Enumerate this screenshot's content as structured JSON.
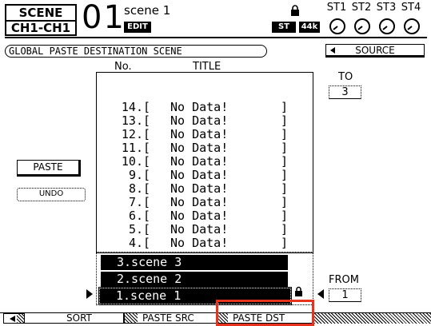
{
  "header": {
    "mode_line1": "SCENE",
    "mode_line2": "CH1-CH1",
    "scene_number": "01",
    "scene_name": "scene 1",
    "edit_badge": "EDIT",
    "st_badge": "ST",
    "sample_rate_badge": "44k",
    "stereo_knobs": [
      {
        "label": "ST1",
        "icon": "knob-icon"
      },
      {
        "label": "ST2",
        "icon": "knob-icon"
      },
      {
        "label": "ST3",
        "icon": "knob-icon"
      },
      {
        "label": "ST4",
        "icon": "knob-icon"
      }
    ]
  },
  "page_title": "GLOBAL PASTE DESTINATION SCENE",
  "source_button": "SOURCE",
  "columns": {
    "no": "No.",
    "title": "TITLE"
  },
  "destination_list": [
    {
      "num": "14.",
      "open": "[",
      "title": "No Data!",
      "close": "]"
    },
    {
      "num": "13.",
      "open": "[",
      "title": "No Data!",
      "close": "]"
    },
    {
      "num": "12.",
      "open": "[",
      "title": "No Data!",
      "close": "]"
    },
    {
      "num": "11.",
      "open": "[",
      "title": "No Data!",
      "close": "]"
    },
    {
      "num": "10.",
      "open": "[",
      "title": "No Data!",
      "close": "]"
    },
    {
      "num": "9.",
      "open": "[",
      "title": "No Data!",
      "close": "]"
    },
    {
      "num": "8.",
      "open": "[",
      "title": "No Data!",
      "close": "]"
    },
    {
      "num": "7.",
      "open": "[",
      "title": "No Data!",
      "close": "]"
    },
    {
      "num": "6.",
      "open": "[",
      "title": "No Data!",
      "close": "]"
    },
    {
      "num": "5.",
      "open": "[",
      "title": "No Data!",
      "close": "]"
    },
    {
      "num": "4.",
      "open": "[",
      "title": "No Data!",
      "close": "]"
    }
  ],
  "source_list": [
    {
      "label": "3.scene 3"
    },
    {
      "label": "2.scene 2"
    },
    {
      "label": "1.scene 1"
    }
  ],
  "buttons": {
    "paste": "PASTE",
    "undo": "UNDO"
  },
  "to": {
    "label": "TO",
    "value": "3"
  },
  "from": {
    "label": "FROM",
    "value": "1"
  },
  "tabs": [
    {
      "label": "SORT"
    },
    {
      "label": "PASTE SRC"
    },
    {
      "label": "PASTE DST"
    }
  ],
  "colors": {
    "highlight": "#e8321e"
  }
}
